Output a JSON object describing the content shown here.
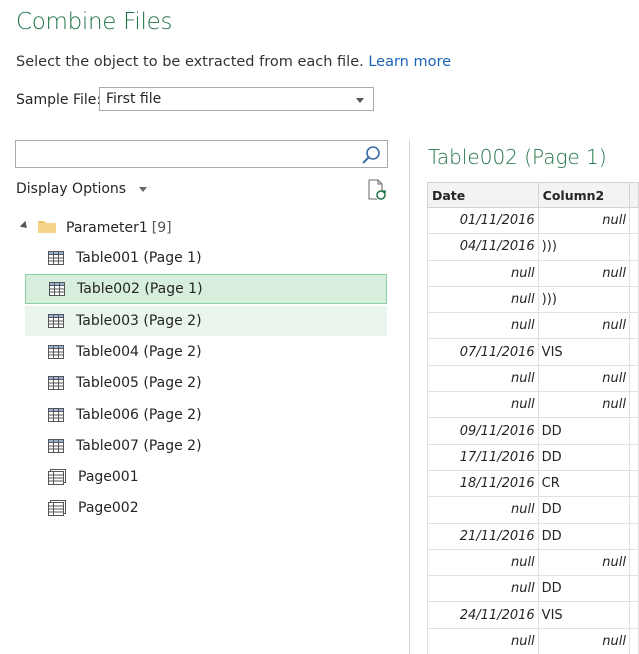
{
  "header": {
    "title": "Combine Files",
    "subtitle": "Select the object to be extracted from each file.",
    "learn_more": "Learn more"
  },
  "sample_file": {
    "label": "Sample File:",
    "value": "First file"
  },
  "search": {
    "placeholder": ""
  },
  "display_options": "Display Options",
  "tree": {
    "folder": {
      "label": "Parameter1",
      "count": "[9]"
    },
    "items": [
      {
        "label": "Table001 (Page 1)",
        "icon": "table-icon"
      },
      {
        "label": "Table002 (Page 1)",
        "icon": "table-icon"
      },
      {
        "label": "Table003 (Page 2)",
        "icon": "table-icon"
      },
      {
        "label": "Table004 (Page 2)",
        "icon": "table-icon"
      },
      {
        "label": "Table005 (Page 2)",
        "icon": "table-icon"
      },
      {
        "label": "Table006 (Page 2)",
        "icon": "table-icon"
      },
      {
        "label": "Table007 (Page 2)",
        "icon": "table-icon"
      },
      {
        "label": "Page001",
        "icon": "page-icon"
      },
      {
        "label": "Page002",
        "icon": "page-icon"
      }
    ]
  },
  "preview": {
    "title": "Table002 (Page 1)",
    "columns": [
      "Date",
      "Column2",
      ""
    ],
    "rows": [
      [
        "01/11/2016",
        "null",
        ""
      ],
      [
        "04/11/2016",
        ")))",
        ""
      ],
      [
        "null",
        "null",
        ""
      ],
      [
        "null",
        ")))",
        ""
      ],
      [
        "null",
        "null",
        ""
      ],
      [
        "07/11/2016",
        "VIS",
        ""
      ],
      [
        "null",
        "null",
        ""
      ],
      [
        "null",
        "null",
        ""
      ],
      [
        "09/11/2016",
        "DD",
        ""
      ],
      [
        "17/11/2016",
        "DD",
        ""
      ],
      [
        "18/11/2016",
        "CR",
        ""
      ],
      [
        "null",
        "DD",
        ""
      ],
      [
        "21/11/2016",
        "DD",
        ""
      ],
      [
        "null",
        "null",
        ""
      ],
      [
        "null",
        "DD",
        ""
      ],
      [
        "24/11/2016",
        "VIS",
        ""
      ],
      [
        "null",
        "null",
        ""
      ]
    ]
  },
  "colors": {
    "accent": "#217346",
    "link": "#1a64b8",
    "selected_bg": "#d7eedd",
    "hover_bg": "#eaf5ed"
  }
}
